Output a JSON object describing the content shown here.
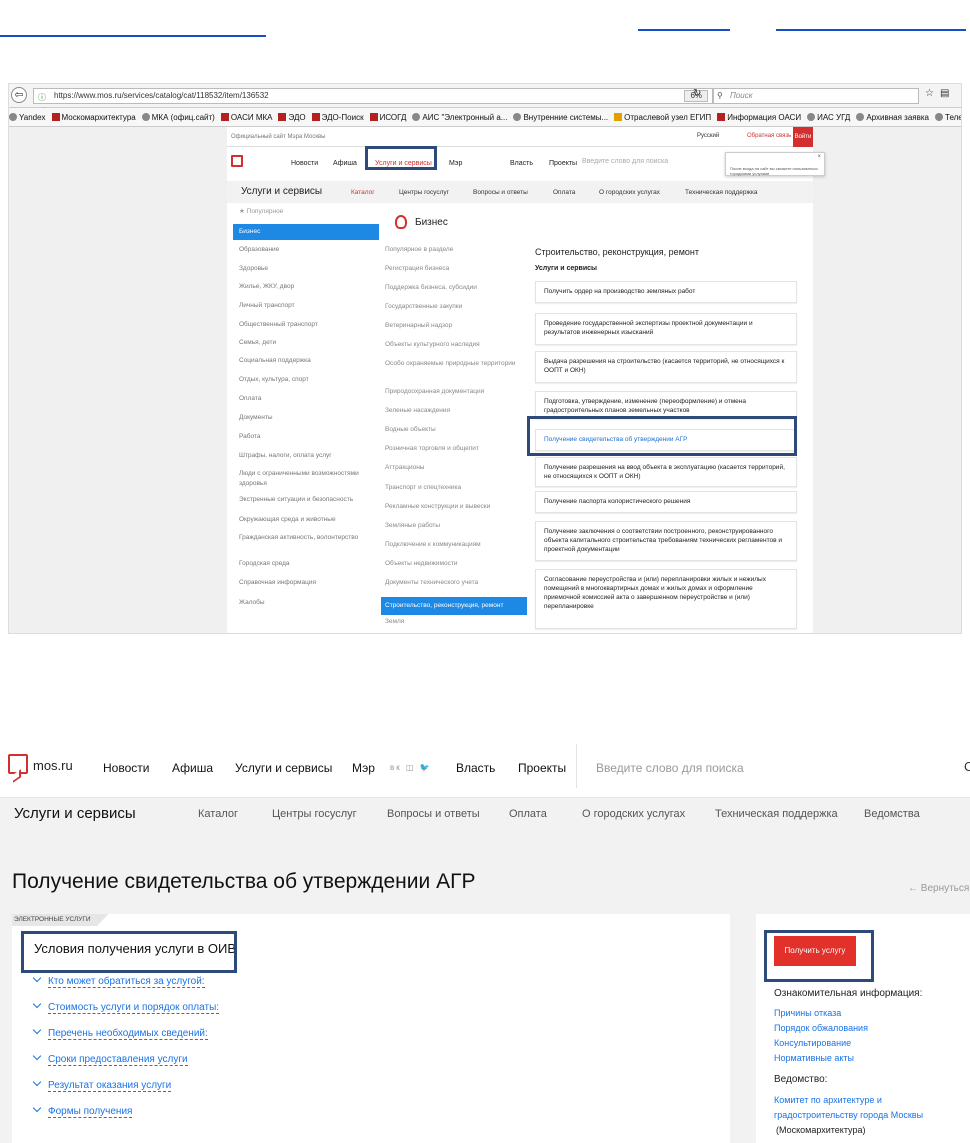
{
  "browser": {
    "url": "https://www.mos.ru/services/catalog/cat/118532/item/136532",
    "zoom": "6%",
    "search_placeholder": "Поиск",
    "bookmarks": [
      "Yandex",
      "Москомархитектура",
      "МКА (офиц.сайт)",
      "ОАСИ МКА",
      "ЭДО",
      "ЭДО-Поиск",
      "ИСОГД",
      "АИС \"Электронный а...",
      "Внутренние системы...",
      "Отраслевой узел ЕГИП",
      "Информация ОАСИ",
      "ИАС УГД",
      "Архивная заявка",
      "Телефонн"
    ]
  },
  "site1": {
    "official": "Официальный сайт Мэра Москвы",
    "lang": "Русский",
    "feedback": "Обратная связь",
    "login": "Войти",
    "nav": [
      "Новости",
      "Афиша",
      "Услуги и сервисы",
      "Мэр",
      "Власть",
      "Проекты"
    ],
    "search": "Введите слово для поиска",
    "tooltip": "После входа на сайт вы сможете пользоваться городскими услугами",
    "sub_title": "Услуги и сервисы",
    "sub_tabs": [
      "Каталог",
      "Центры госуслуг",
      "Вопросы и ответы",
      "Оплата",
      "О городских услугах",
      "Техническая поддержка"
    ],
    "popular": "Популярное",
    "categories": [
      "Бизнес",
      "Образование",
      "Здоровье",
      "Жилье, ЖКУ, двор",
      "Личный транспорт",
      "Общественный транспорт",
      "Семья, дети",
      "Социальная поддержка",
      "Отдых, культура, спорт",
      "Оплата",
      "Документы",
      "Работа",
      "Штрафы, налоги, оплата услуг",
      "Люди с ограниченными возможностями здоровья",
      "Экстренные ситуации и безопасность",
      "Окружающая среда и животные",
      "Гражданская активность, волонтерство",
      "Городская среда",
      "Справочная информация",
      "Жалобы"
    ],
    "section": "Бизнес",
    "subcategories": [
      "Популярное в разделе",
      "Регистрация бизнеса",
      "Поддержка бизнеса, субсидии",
      "Государственные закупки",
      "Ветеринарный надзор",
      "Объекты культурного наследия",
      "Особо охраняемые природные территории",
      "Природоохранная документация",
      "Зеленые насаждения",
      "Водные объекты",
      "Розничная торговля и общепит",
      "Аттракционы",
      "Транспорт и спецтехника",
      "Рекламные конструкции и вывески",
      "Земляные работы",
      "Подключение к коммуникациям",
      "Объекты недвижимости",
      "Документы технического учета",
      "Строительство, реконструкция, ремонт",
      "Земля"
    ],
    "right_title": "Строительство, реконструкция, ремонт",
    "right_subtitle": "Услуги и сервисы",
    "services": [
      "Получить ордер на производство земляных работ",
      "Проведение государственной экспертизы проектной документации и результатов инженерных изысканий",
      "Выдача разрешения на строительство (касается территорий, не относящихся к ООПТ и ОКН)",
      "Подготовка, утверждение, изменение (переоформление) и отмена градостроительных планов земельных участков",
      "Получение свидетельства об утверждении АГР",
      "Получение разрешения на ввод объекта в эксплуатацию (касается территорий, не относящихся к ООПТ и ОКН)",
      "Получение паспорта колористического решения",
      "Получение заключения о соответствии построенного, реконструированного объекта капитального строительства требованиям технических регламентов и проектной документации",
      "Согласование переустройства и (или) перепланировки жилых и нежилых помещений в многоквартирных домах и жилых домах и оформление приемочной комиссией акта о завершенном переустройстве и (или) перепланировке"
    ]
  },
  "site2": {
    "logo": "mos.ru",
    "nav": [
      "Новости",
      "Афиша",
      "Услуги и сервисы",
      "Мэр",
      "Власть",
      "Проекты"
    ],
    "social": "вк ◫ 🐦",
    "search": "Введите слово для поиска",
    "cut": "С",
    "sub_title": "Услуги и сервисы",
    "sub_tabs": [
      "Каталог",
      "Центры госуслуг",
      "Вопросы и ответы",
      "Оплата",
      "О городских услугах",
      "Техническая поддержка",
      "Ведомства"
    ],
    "page_title": "Получение свидетельства об утверждении АГР",
    "back": "← Вернуться",
    "tag": "ЭЛЕКТРОННЫЕ УСЛУГИ",
    "panel_title": "Условия получения услуги в ОИВ",
    "accordion": [
      "Кто может обратиться за услугой:",
      "Стоимость услуги и порядок оплаты:",
      "Перечень необходимых сведений:",
      "Сроки предоставления услуги",
      "Результат оказания услуги",
      "Формы получения"
    ],
    "get_service": "Получить услугу",
    "info_label": "Ознакомительная информация:",
    "info_links": [
      "Причины отказа",
      "Порядок обжалования",
      "Консультирование",
      "Нормативные акты"
    ],
    "dept_label": "Ведомство:",
    "dept_link_1": "Комитет по архитектуре и",
    "dept_link_2": "градостроительству города Москвы",
    "dept_short": "(Москомархитектура)"
  }
}
